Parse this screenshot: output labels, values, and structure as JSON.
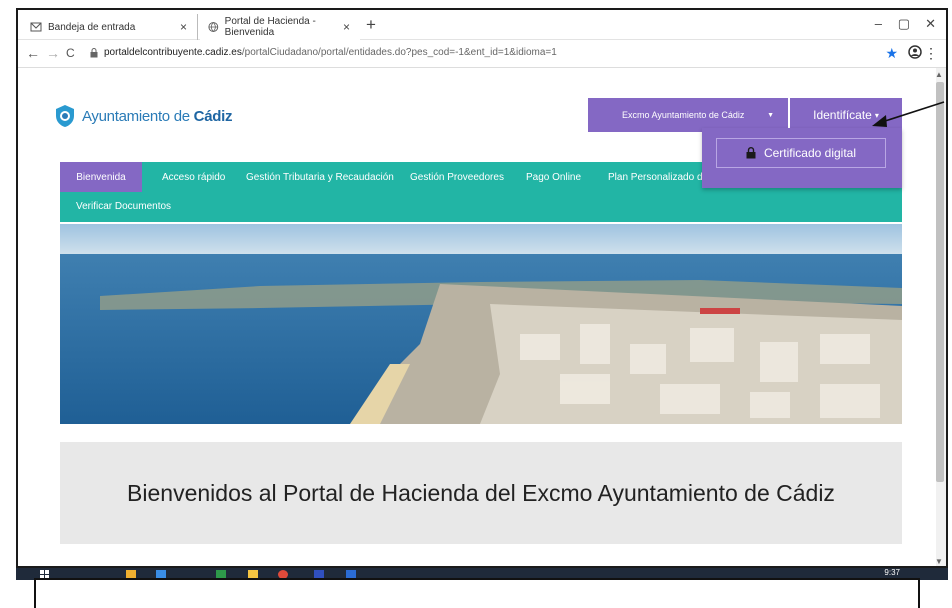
{
  "browser": {
    "tabs": [
      {
        "title": "Bandeja de entrada",
        "active": false
      },
      {
        "title": "Portal de Hacienda - Bienvenida",
        "active": true
      }
    ],
    "new_tab": "+",
    "close_glyph": "×",
    "window_controls": [
      "–",
      "▢",
      "✕"
    ],
    "url_host": "portaldelcontribuyente.cadiz.es",
    "url_path": "/portalCiudadano/portal/entidades.do?pes_cod=-1&ent_id=1&idioma=1",
    "nav": {
      "back": "←",
      "forward": "→",
      "reload": "C"
    }
  },
  "header": {
    "logo_prefix": "Ayuntamiento de ",
    "logo_bold": "Cádiz",
    "entity_select": "Excmo Ayuntamiento de Cádiz",
    "identify_button": "Identifícate",
    "dropdown": {
      "cert_label": "Certificado digital"
    }
  },
  "menu": {
    "items": [
      {
        "label": "Bienvenida",
        "active": true
      },
      {
        "label": "Acceso rápido",
        "active": false
      },
      {
        "label": "Gestión Tributaria y Recaudación",
        "active": false
      },
      {
        "label": "Gestión Proveedores",
        "active": false
      },
      {
        "label": "Pago Online",
        "active": false
      },
      {
        "label": "Plan Personalizado de",
        "active": false
      },
      {
        "label": "Verificar Documentos",
        "active": false
      }
    ]
  },
  "main": {
    "welcome": "Bienvenidos al Portal de Hacienda del Excmo Ayuntamiento de Cádiz"
  },
  "taskbar": {
    "time": "9:37"
  },
  "colors": {
    "purple": "#8468c4",
    "teal": "#22b5a5",
    "logo_blue": "#2a7bb7",
    "welcome_bg": "#e8e8e8"
  }
}
